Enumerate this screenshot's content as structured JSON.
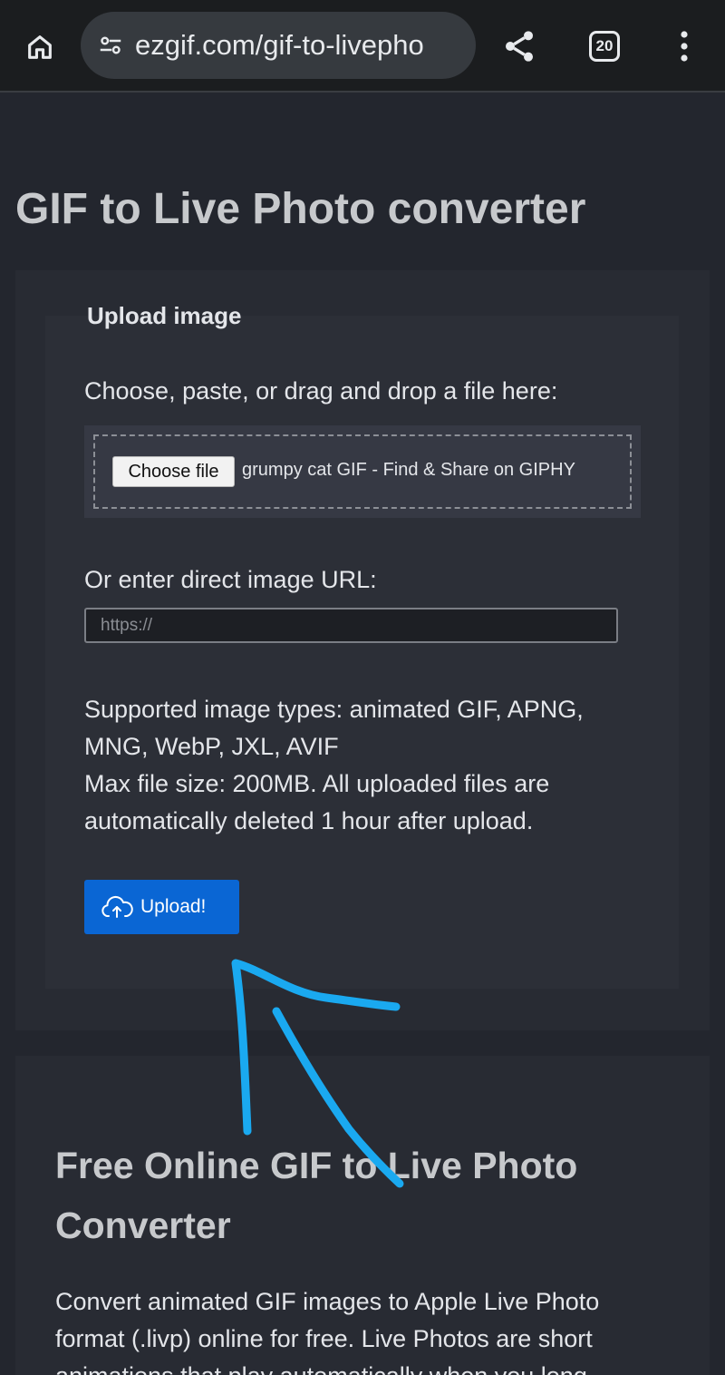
{
  "browser": {
    "url_text": "ezgif.com/gif-to-livepho",
    "tab_count": "20",
    "icons": [
      "home-icon",
      "site-settings-icon",
      "share-icon",
      "tabs-icon",
      "more-menu-icon"
    ]
  },
  "page": {
    "title": "GIF to Live Photo converter"
  },
  "upload_form": {
    "legend": "Upload image",
    "choose_label": "Choose, paste, or drag and drop a file here:",
    "choose_button": "Choose file",
    "file_name": "grumpy cat GIF - Find & Share on GIPHY",
    "url_label": "Or enter direct image URL:",
    "url_placeholder": "https://",
    "supported_types": "Supported image types: animated GIF, APNG, MNG, WebP, JXL, AVIF",
    "max_size": "Max file size: 200MB. All uploaded files are automatically deleted 1 hour after upload.",
    "upload_button": "Upload!",
    "upload_icon": "cloud-upload-icon",
    "accent_color": "#0a66d4"
  },
  "info": {
    "title": "Free Online GIF to Live Photo Converter",
    "text": "Convert animated GIF images to Apple Live Photo format (.livp) online for free. Live Photos are short animations that play automatically when you long"
  },
  "annotation": {
    "kind": "hand-drawn arrow pointing at upload button",
    "color": "#1aa9f0"
  }
}
